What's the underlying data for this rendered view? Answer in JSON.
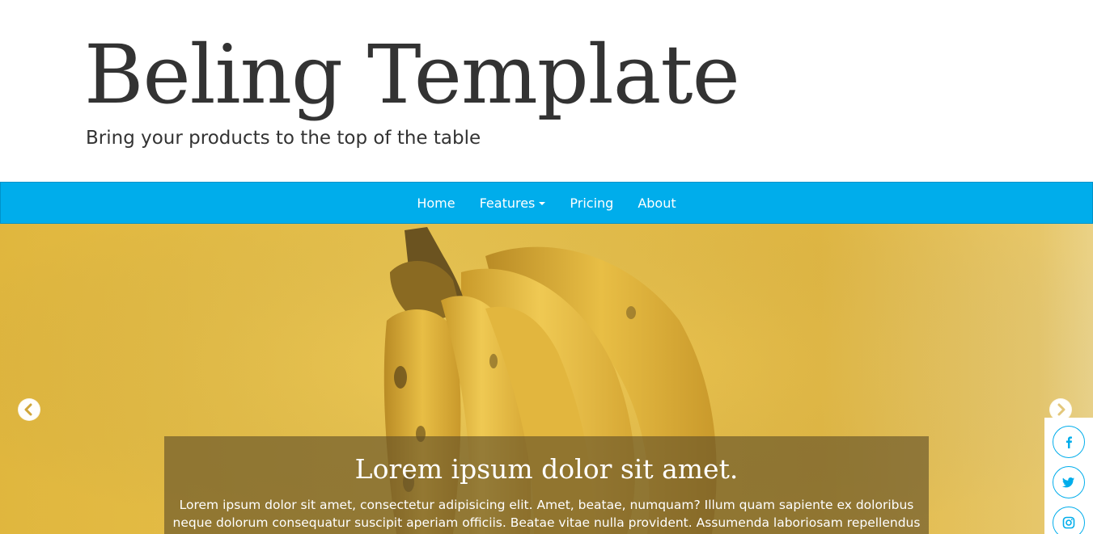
{
  "header": {
    "site_title": "Beling Template",
    "tagline": "Bring your products to the top of the table"
  },
  "nav": {
    "items": [
      {
        "label": "Home"
      },
      {
        "label": "Features",
        "has_dropdown": true
      },
      {
        "label": "Pricing"
      },
      {
        "label": "About"
      }
    ]
  },
  "hero": {
    "image_subject": "bananas-on-yellow-background",
    "caption_title": "Lorem ipsum dolor sit amet.",
    "caption_text": "Lorem ipsum dolor sit amet, consectetur adipisicing elit. Amet, beatae, numquam? Illum quam sapiente ex doloribus neque dolorum consequatur suscipit aperiam officiis. Beatae vitae nulla provident. Assumenda laboriosam repellendus possimus nulla Dolor tenetur facilis voluptas, nostrum distinctio amet, ipsam?",
    "prev_icon": "chevron-left-circle-icon",
    "next_icon": "chevron-right-circle-icon"
  },
  "social": {
    "items": [
      {
        "icon": "facebook-icon"
      },
      {
        "icon": "twitter-icon"
      },
      {
        "icon": "instagram-icon"
      }
    ]
  },
  "colors": {
    "accent": "#00adeb",
    "text": "#333333",
    "hero_yellow": "#f1cc57"
  }
}
